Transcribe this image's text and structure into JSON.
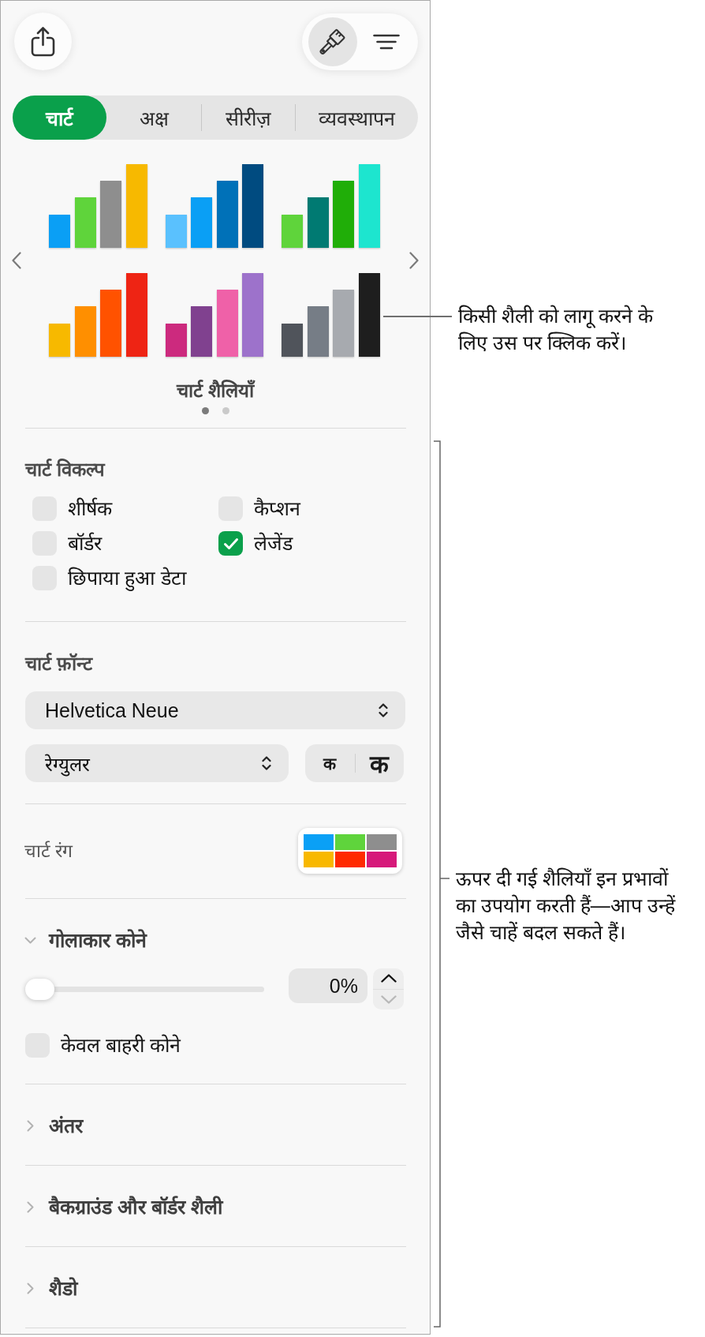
{
  "toolbar_modes": [
    {
      "kind": "format",
      "selected": true
    },
    {
      "kind": "organize",
      "selected": false
    }
  ],
  "tabs": [
    {
      "label": "चार्ट",
      "selected": true
    },
    {
      "label": "अक्ष",
      "selected": false
    },
    {
      "label": "सीरीज़",
      "selected": false
    },
    {
      "label": "व्यवस्थापन",
      "selected": false
    }
  ],
  "chart_styles": {
    "styles": [
      {
        "bars": [
          {
            "color": "#0a9ff5"
          },
          {
            "color": "#5fd43b"
          },
          {
            "color": "#8e8e8e"
          },
          {
            "color": "#f7b900"
          }
        ]
      },
      {
        "bars": [
          {
            "color": "#5ac1fe"
          },
          {
            "color": "#0a9ff5"
          },
          {
            "color": "#0071b8"
          },
          {
            "color": "#004b80"
          }
        ]
      },
      {
        "bars": [
          {
            "color": "#5fd43b"
          },
          {
            "color": "#007a72"
          },
          {
            "color": "#20ae08"
          },
          {
            "color": "#1de5cf"
          }
        ]
      },
      {
        "bars": [
          {
            "color": "#f7b900"
          },
          {
            "color": "#ff8f00"
          },
          {
            "color": "#ff5200"
          },
          {
            "color": "#ee2414"
          }
        ]
      },
      {
        "bars": [
          {
            "color": "#cc2a7e"
          },
          {
            "color": "#80418f"
          },
          {
            "color": "#ef61a8"
          },
          {
            "color": "#9d72cb"
          }
        ]
      },
      {
        "bars": [
          {
            "color": "#50545b"
          },
          {
            "color": "#767d86"
          },
          {
            "color": "#a7aaaf"
          },
          {
            "color": "#1e1e1e"
          }
        ]
      }
    ],
    "label": "चार्ट शैलियाँ",
    "pages": [
      {
        "selected": true
      },
      {
        "selected": false
      }
    ]
  },
  "chart_options": {
    "title": "चार्ट विकल्प",
    "options": [
      {
        "label": "शीर्षक",
        "checked": false
      },
      {
        "label": "कैप्शन",
        "checked": false
      },
      {
        "label": "बॉर्डर",
        "checked": false
      },
      {
        "label": "लेजेंड",
        "checked": true
      },
      {
        "label": "छिपाया हुआ डेटा",
        "checked": false
      }
    ]
  },
  "chart_font": {
    "title": "चार्ट फ़ॉन्ट",
    "font": {
      "value": "Helvetica Neue"
    },
    "style": {
      "value": "रेग्युलर"
    },
    "size_buttons": [
      {
        "kind": "smaller",
        "label": "क"
      },
      {
        "kind": "larger",
        "label": "क"
      }
    ]
  },
  "chart_colors": {
    "label": "चार्ट रंग",
    "swatches": [
      {
        "color": "#0aa0f6"
      },
      {
        "color": "#5fd43c"
      },
      {
        "color": "#8e8e8e"
      },
      {
        "color": "#f8b800"
      },
      {
        "color": "#ff2a00"
      },
      {
        "color": "#d6197a"
      }
    ]
  },
  "rounded_corners": {
    "title": "गोलाकार कोने",
    "expanded": true,
    "slider": {
      "level": 0
    },
    "value": "0%",
    "stepper": [
      {
        "kind": "up",
        "disabled": false
      },
      {
        "kind": "down",
        "disabled": true
      }
    ],
    "outer_only": {
      "label": "केवल बाहरी कोने",
      "checked": false
    }
  },
  "sections": [
    {
      "title": "अंतर",
      "expanded": false
    },
    {
      "title": "बैकग्राउंड और बॉर्डर शैली",
      "expanded": false
    },
    {
      "title": "शैडो",
      "expanded": false
    }
  ],
  "callouts": [
    {
      "kind": "leader",
      "text": "किसी शैली को लागू करने के लिए उस पर क्लिक करें।"
    },
    {
      "kind": "bracket",
      "text": "ऊपर दी गई शैलियाँ इन प्रभावों का उपयोग करती हैं—आप उन्हें जैसे चाहें बदल सकते हैं।"
    }
  ]
}
